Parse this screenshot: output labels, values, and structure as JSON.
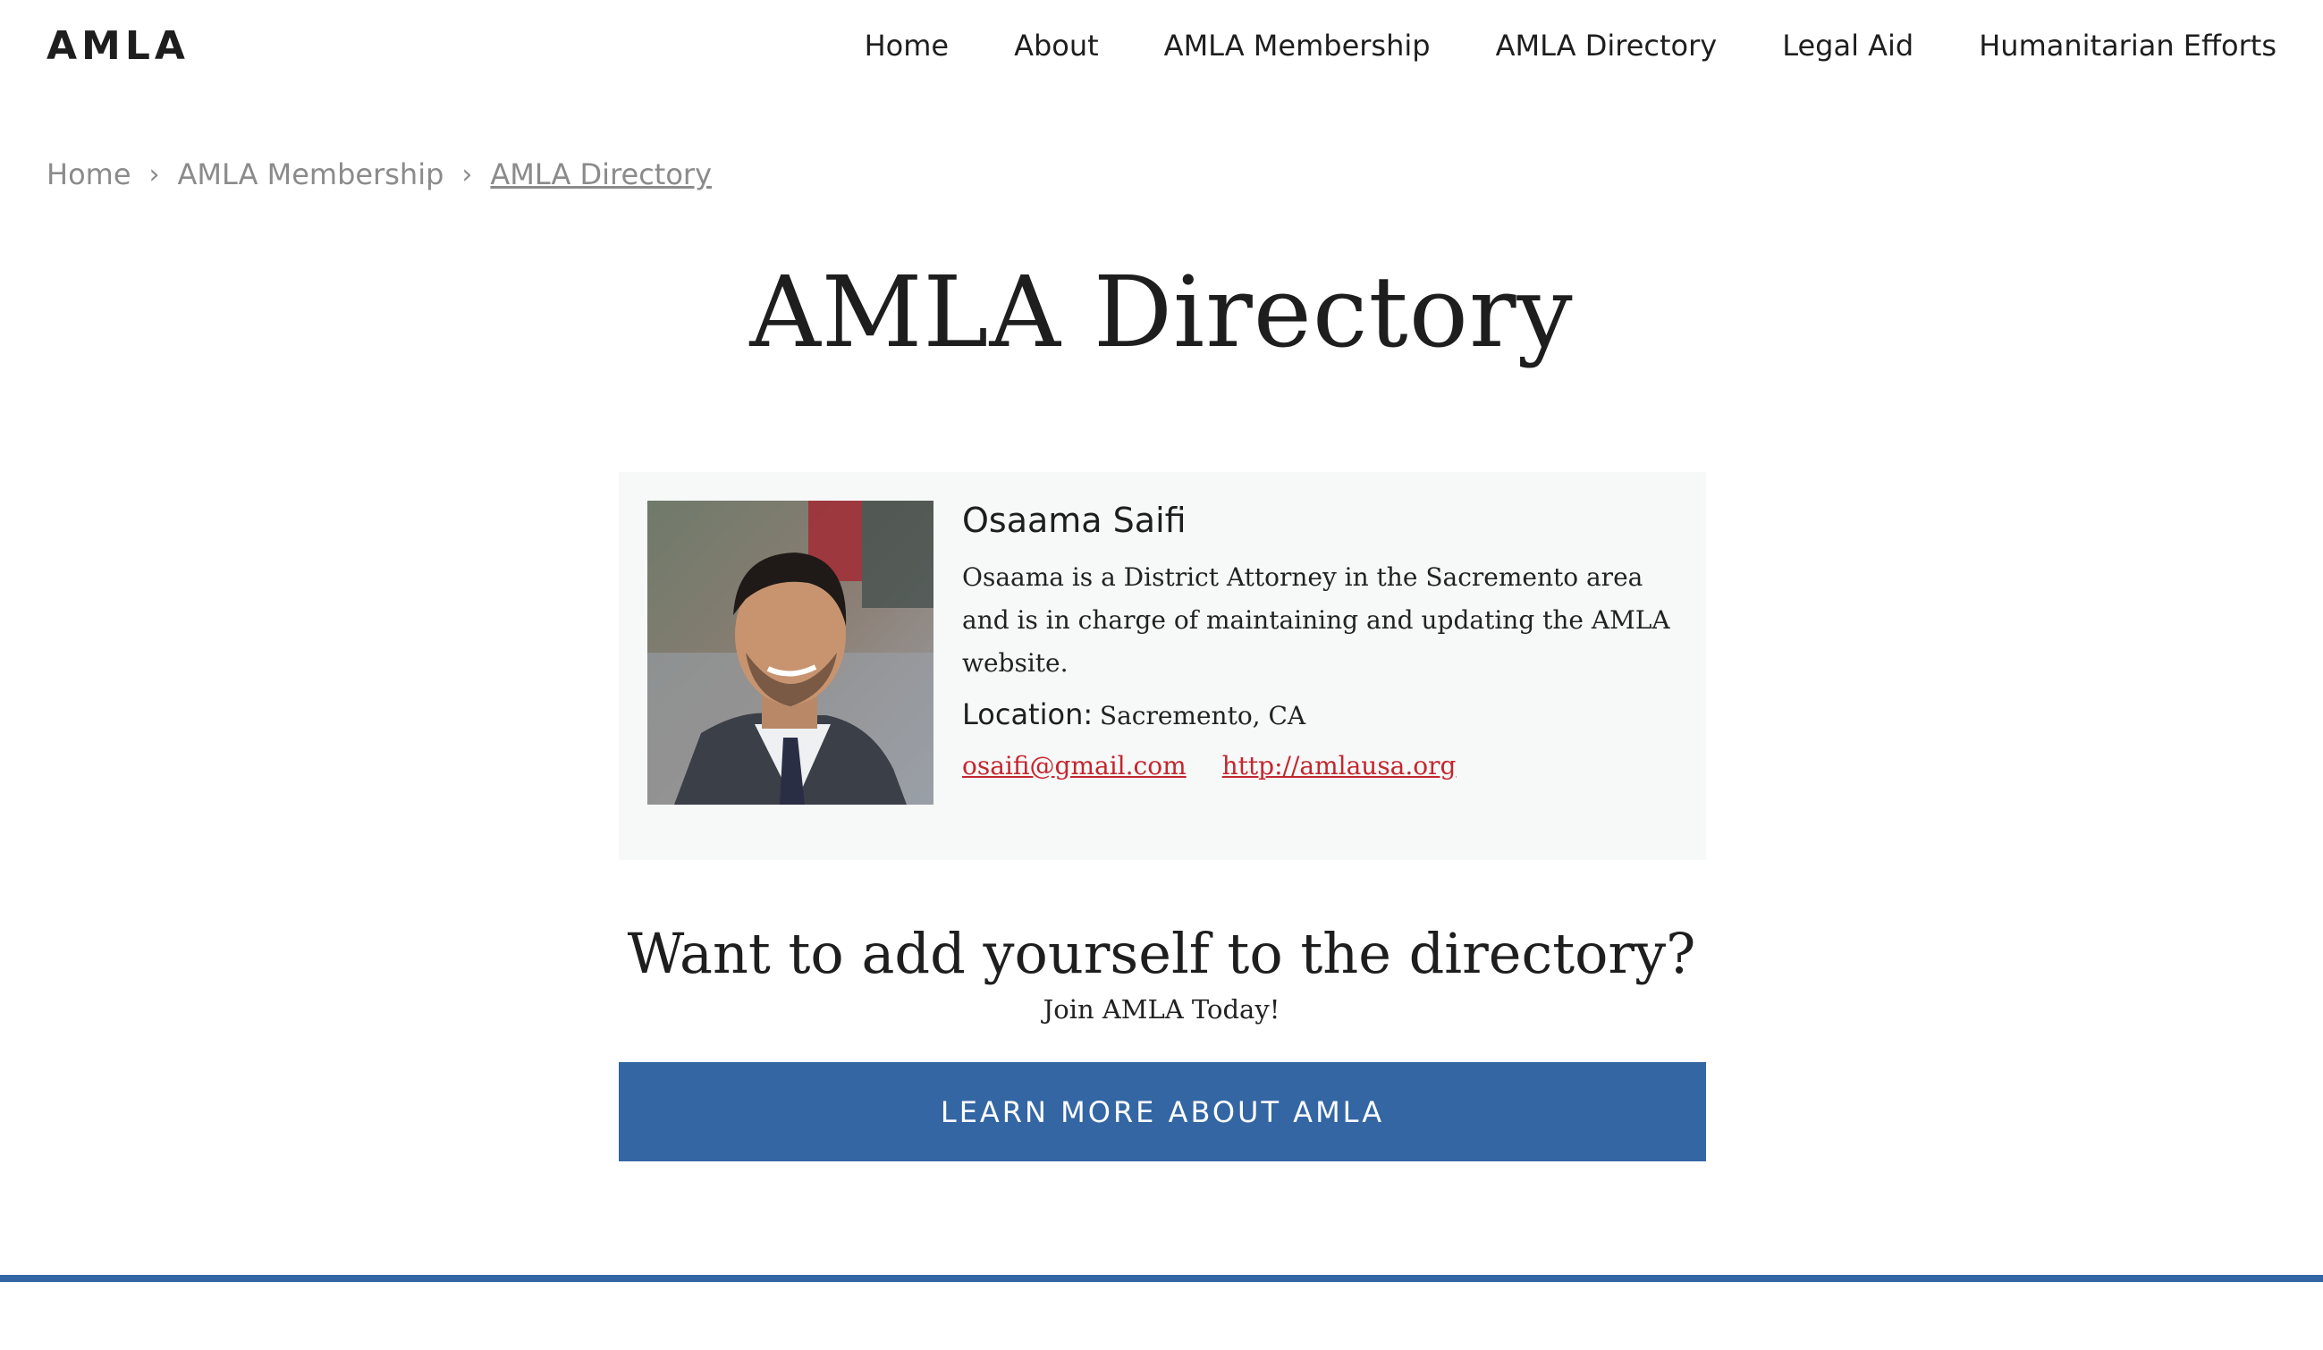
{
  "header": {
    "logo": "AMLA",
    "nav": [
      {
        "label": "Home"
      },
      {
        "label": "About"
      },
      {
        "label": "AMLA Membership"
      },
      {
        "label": "AMLA Directory"
      },
      {
        "label": "Legal Aid"
      },
      {
        "label": "Humanitarian Efforts"
      }
    ]
  },
  "breadcrumb": {
    "items": [
      "Home",
      "AMLA Membership",
      "AMLA Directory"
    ],
    "separator": "›"
  },
  "page": {
    "title": "AMLA Directory"
  },
  "member": {
    "name": "Osaama Saifi",
    "bio": "Osaama is a District Attorney in the Sacremento area and is in charge of maintaining and updating the AMLA website.",
    "location_label": "Location:",
    "location_value": "Sacremento, CA",
    "email": "osaifi@gmail.com",
    "website": "http://amlausa.org"
  },
  "cta": {
    "heading": "Want to add yourself to the directory?",
    "subtext": "Join AMLA Today!",
    "button_label": "LEARN MORE ABOUT AMLA"
  },
  "colors": {
    "accent": "#3466a4",
    "link": "#c4262e",
    "card_bg": "#f7f8f8",
    "muted_text": "#8b8b8b"
  }
}
